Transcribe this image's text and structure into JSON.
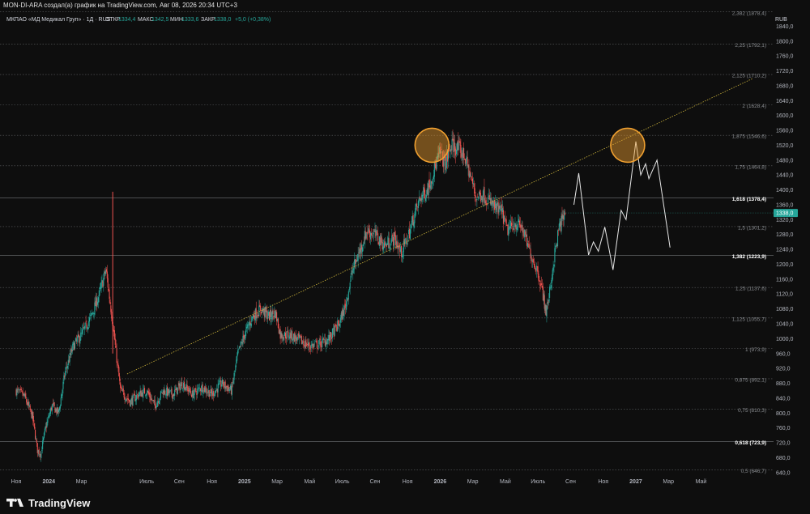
{
  "header": {
    "caption": "MON-DI-ARA создал(а) график на TradingView.com, Авг 08, 2026 20:34 UTC+3"
  },
  "legend": {
    "symbol": "МКПАО «МД Медикал Груп» · 1Д · RUS",
    "open_label": "ОТКР",
    "open": "1334,4",
    "high_label": "МАКС",
    "high": "1342,5",
    "low_label": "МИН",
    "low": "1333,6",
    "close_label": "ЗАКР",
    "close": "1338,0",
    "change": "+5,0 (+0,38%)"
  },
  "currency": "RUB",
  "last_price": "1338,0",
  "footer": {
    "logo_text": "TradingView"
  },
  "colors": {
    "background": "#0e0e0e",
    "up": "#26a69a",
    "down": "#ef5350",
    "fib_line": "#5d6063",
    "trendline": "#c9b13a",
    "circle": "#f0a030",
    "projection": "#e8e8e8",
    "last_price_bg": "#26a69a"
  },
  "chart_data": {
    "type": "candlestick",
    "symbol": "МКПАО «МД Медикал Груп»",
    "timeframe": "1Д",
    "ylim": [
      620,
      1880
    ],
    "y_ticks": [
      "640,0",
      "680,0",
      "720,0",
      "760,0",
      "800,0",
      "840,0",
      "880,0",
      "920,0",
      "960,0",
      "1000,0",
      "1040,0",
      "1080,0",
      "1120,0",
      "1160,0",
      "1200,0",
      "1240,0",
      "1280,0",
      "1320,0",
      "1360,0",
      "1400,0",
      "1440,0",
      "1480,0",
      "1520,0",
      "1560,0",
      "1600,0",
      "1640,0",
      "1680,0",
      "1720,0",
      "1760,0",
      "1800,0",
      "1840,0"
    ],
    "x_ticks": [
      {
        "label": "Ноя",
        "t": 0.0
      },
      {
        "label": "2024",
        "t": 2.0
      },
      {
        "label": "Мар",
        "t": 4.0
      },
      {
        "label": "Июль",
        "t": 8.0
      },
      {
        "label": "Сен",
        "t": 10.0
      },
      {
        "label": "Ноя",
        "t": 12.0
      },
      {
        "label": "2025",
        "t": 14.0
      },
      {
        "label": "Мар",
        "t": 16.0
      },
      {
        "label": "Май",
        "t": 18.0
      },
      {
        "label": "Июль",
        "t": 20.0
      },
      {
        "label": "Сен",
        "t": 22.0
      },
      {
        "label": "Ноя",
        "t": 24.0
      },
      {
        "label": "2026",
        "t": 26.0
      },
      {
        "label": "Мар",
        "t": 28.0
      },
      {
        "label": "Май",
        "t": 30.0
      },
      {
        "label": "Июль",
        "t": 32.0
      },
      {
        "label": "Сен",
        "t": 34.0
      },
      {
        "label": "Ноя",
        "t": 36.0
      },
      {
        "label": "2027",
        "t": 38.0
      },
      {
        "label": "Мар",
        "t": 40.0
      },
      {
        "label": "Май",
        "t": 42.0
      }
    ],
    "fib_levels": [
      {
        "ratio": "0,5",
        "price": 646.7,
        "label": "0,5 (646,7)",
        "bold": false
      },
      {
        "ratio": "0,618",
        "price": 723.9,
        "label": "0,618 (723,9)",
        "bold": true
      },
      {
        "ratio": "0,75",
        "price": 810.3,
        "label": "0,75 (810,3)",
        "bold": false
      },
      {
        "ratio": "0,875",
        "price": 892.1,
        "label": "0,875 (892,1)",
        "bold": false
      },
      {
        "ratio": "1",
        "price": 973.9,
        "label": "1 (973,9)",
        "bold": false
      },
      {
        "ratio": "1,125",
        "price": 1055.7,
        "label": "1,125 (1055,7)",
        "bold": false
      },
      {
        "ratio": "1,25",
        "price": 1137.6,
        "label": "1,25 (1137,6)",
        "bold": false
      },
      {
        "ratio": "1,382",
        "price": 1223.9,
        "label": "1,382 (1223,9)",
        "bold": true
      },
      {
        "ratio": "1,5",
        "price": 1301.2,
        "label": "1,5 (1301,2)",
        "bold": false
      },
      {
        "ratio": "1,618",
        "price": 1378.4,
        "label": "1,618 (1378,4)",
        "bold": true
      },
      {
        "ratio": "1,75",
        "price": 1464.8,
        "label": "1,75 (1464,8)",
        "bold": false
      },
      {
        "ratio": "1,875",
        "price": 1546.6,
        "label": "1,875 (1546,6)",
        "bold": false
      },
      {
        "ratio": "2",
        "price": 1628.4,
        "label": "2 (1628,4)",
        "bold": false
      },
      {
        "ratio": "2,125",
        "price": 1710.2,
        "label": "2,125 (1710,2)",
        "bold": false
      },
      {
        "ratio": "2,25",
        "price": 1792.1,
        "label": "2,25 (1792,1)",
        "bold": false
      },
      {
        "ratio": "2,382",
        "price": 1878.4,
        "label": "2,382 (1878,4)",
        "bold": false
      }
    ],
    "price_path": [
      [
        0.0,
        860
      ],
      [
        0.5,
        845
      ],
      [
        1.0,
        790
      ],
      [
        1.3,
        700
      ],
      [
        1.5,
        690
      ],
      [
        1.8,
        760
      ],
      [
        2.2,
        820
      ],
      [
        2.6,
        800
      ],
      [
        3.0,
        910
      ],
      [
        3.5,
        980
      ],
      [
        4.0,
        1010
      ],
      [
        4.6,
        1060
      ],
      [
        5.1,
        1120
      ],
      [
        5.5,
        1185
      ],
      [
        5.9,
        1050
      ],
      [
        6.1,
        970
      ],
      [
        6.4,
        860
      ],
      [
        7.0,
        830
      ],
      [
        7.5,
        850
      ],
      [
        8.0,
        860
      ],
      [
        8.5,
        820
      ],
      [
        9.0,
        860
      ],
      [
        9.6,
        850
      ],
      [
        10.2,
        880
      ],
      [
        10.8,
        850
      ],
      [
        11.4,
        870
      ],
      [
        12.0,
        850
      ],
      [
        12.6,
        880
      ],
      [
        13.2,
        860
      ],
      [
        13.6,
        960
      ],
      [
        14.0,
        1010
      ],
      [
        14.5,
        1060
      ],
      [
        15.0,
        1080
      ],
      [
        15.5,
        1060
      ],
      [
        15.9,
        1070
      ],
      [
        16.2,
        1010
      ],
      [
        16.8,
        1010
      ],
      [
        17.4,
        995
      ],
      [
        18.0,
        980
      ],
      [
        18.6,
        985
      ],
      [
        19.2,
        1000
      ],
      [
        19.8,
        1040
      ],
      [
        20.2,
        1090
      ],
      [
        20.6,
        1180
      ],
      [
        21.1,
        1240
      ],
      [
        21.5,
        1290
      ],
      [
        22.0,
        1280
      ],
      [
        22.6,
        1250
      ],
      [
        23.2,
        1270
      ],
      [
        23.6,
        1230
      ],
      [
        24.0,
        1270
      ],
      [
        24.4,
        1330
      ],
      [
        24.8,
        1380
      ],
      [
        25.2,
        1400
      ],
      [
        25.6,
        1450
      ],
      [
        26.0,
        1500
      ],
      [
        26.3,
        1470
      ],
      [
        26.7,
        1520
      ],
      [
        27.1,
        1510
      ],
      [
        27.5,
        1490
      ],
      [
        27.9,
        1430
      ],
      [
        28.2,
        1380
      ],
      [
        28.6,
        1390
      ],
      [
        29.0,
        1370
      ],
      [
        29.4,
        1350
      ],
      [
        29.8,
        1340
      ],
      [
        30.1,
        1290
      ],
      [
        30.6,
        1310
      ],
      [
        31.0,
        1300
      ],
      [
        31.3,
        1260
      ],
      [
        31.7,
        1210
      ],
      [
        32.0,
        1180
      ],
      [
        32.3,
        1120
      ],
      [
        32.5,
        1070
      ],
      [
        32.7,
        1120
      ],
      [
        33.0,
        1220
      ],
      [
        33.3,
        1300
      ],
      [
        33.7,
        1338
      ]
    ],
    "projection": [
      [
        34.2,
        1360
      ],
      [
        34.5,
        1445
      ],
      [
        35.1,
        1225
      ],
      [
        35.4,
        1260
      ],
      [
        35.7,
        1235
      ],
      [
        36.1,
        1300
      ],
      [
        36.6,
        1185
      ],
      [
        37.1,
        1345
      ],
      [
        37.4,
        1320
      ],
      [
        38.0,
        1530
      ],
      [
        38.3,
        1440
      ],
      [
        38.6,
        1470
      ],
      [
        38.8,
        1430
      ],
      [
        39.3,
        1480
      ],
      [
        40.1,
        1245
      ]
    ],
    "trendline": {
      "start": [
        6.8,
        905
      ],
      "end": [
        45.2,
        1700
      ]
    },
    "highlight_circles": [
      {
        "t": 25.5,
        "price": 1520
      },
      {
        "t": 37.5,
        "price": 1520
      }
    ],
    "spike": {
      "t": 5.92,
      "high": 1395,
      "low": 960
    }
  }
}
